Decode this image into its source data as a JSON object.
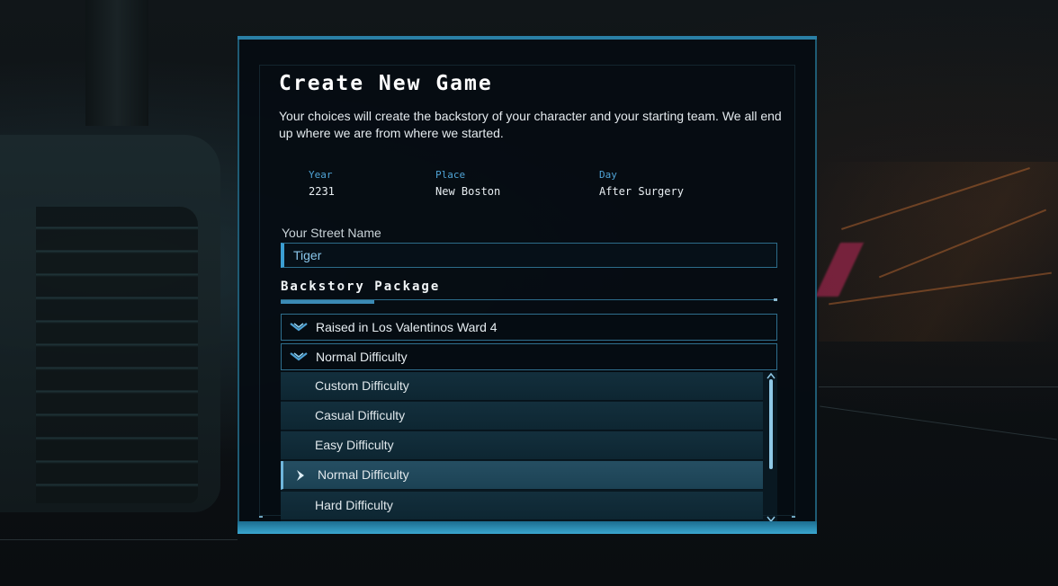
{
  "dialog": {
    "title": "Create New Game",
    "subtitle": "Your choices will create the backstory of your character and your starting team. We all end up where we are from where we started."
  },
  "info": [
    {
      "label": "Year",
      "value": "2231"
    },
    {
      "label": "Place",
      "value": "New Boston"
    },
    {
      "label": "Day",
      "value": "After Surgery"
    }
  ],
  "street_name": {
    "label": "Your Street Name",
    "value": "Tiger"
  },
  "backstory": {
    "title": "Backstory Package",
    "origin_dropdown": "Raised in Los Valentinos Ward 4",
    "difficulty_dropdown": "Normal Difficulty",
    "options": [
      "Custom Difficulty",
      "Casual Difficulty",
      "Easy Difficulty",
      "Normal Difficulty",
      "Hard Difficulty"
    ],
    "selected_option": "Normal Difficulty"
  },
  "colors": {
    "accent": "#3b9ed2",
    "frame": "#2a7fa5",
    "label_blue": "#4fa3d6",
    "input_text": "#89c6ea"
  },
  "icons": {
    "dropdown": "chevron-down-icon",
    "selected": "diamond-arrow-icon",
    "scroll_up": "chevron-up-icon",
    "scroll_down": "chevron-down-icon"
  }
}
